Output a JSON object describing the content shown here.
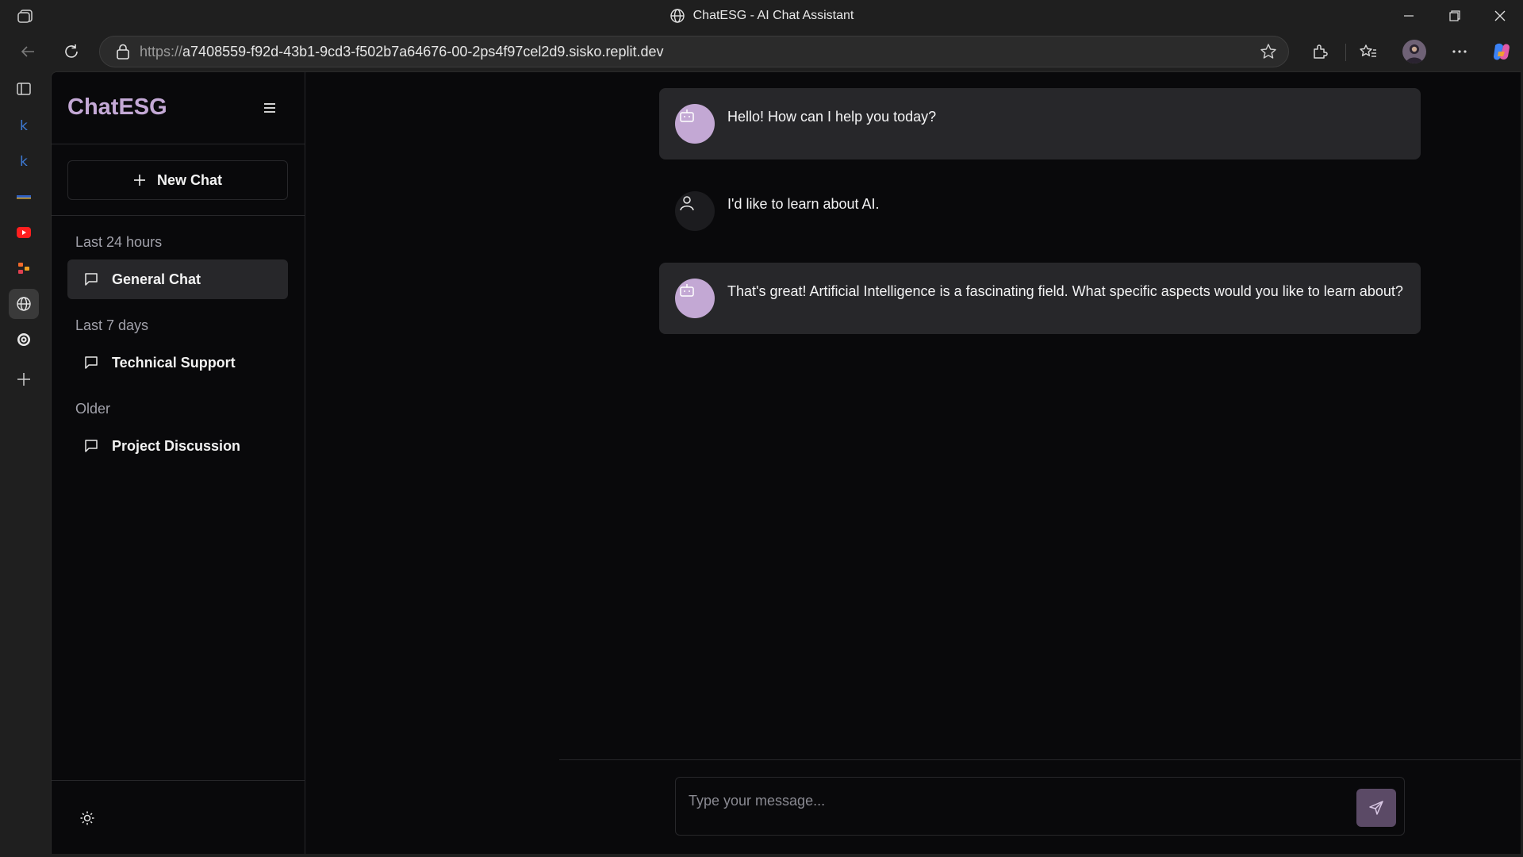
{
  "window": {
    "title": "ChatESG - AI Chat Assistant"
  },
  "browser": {
    "url_scheme": "https://",
    "url_rest": "a7408559-f92d-43b1-9cd3-f502b7a64676-00-2ps4f97cel2d9.sisko.replit.dev",
    "strip_icons": [
      "tab-actions-icon",
      "k-app-icon",
      "k-app-icon",
      "bookmark-bar-icon",
      "youtube-icon",
      "tasks-app-icon",
      "globe-icon",
      "openai-icon",
      "add-icon"
    ]
  },
  "sidebar": {
    "brand": "ChatESG",
    "new_chat_label": "New Chat",
    "sections": [
      {
        "label": "Last 24 hours",
        "items": [
          {
            "label": "General Chat",
            "active": true
          }
        ]
      },
      {
        "label": "Last 7 days",
        "items": [
          {
            "label": "Technical Support",
            "active": false
          }
        ]
      },
      {
        "label": "Older",
        "items": [
          {
            "label": "Project Discussion",
            "active": false
          }
        ]
      }
    ]
  },
  "messages": [
    {
      "role": "assistant",
      "text": "Hello! How can I help you today?"
    },
    {
      "role": "user",
      "text": "I'd like to learn about AI."
    },
    {
      "role": "assistant",
      "text": "That's great! Artificial Intelligence is a fascinating field. What specific aspects would you like to learn about?"
    }
  ],
  "composer": {
    "placeholder": "Type your message..."
  },
  "colors": {
    "brand": "#c4a9d6",
    "bot_avatar": "#c3a8d4",
    "send_button": "#5b4a66",
    "panel": "#27272a",
    "background": "#09090b"
  }
}
